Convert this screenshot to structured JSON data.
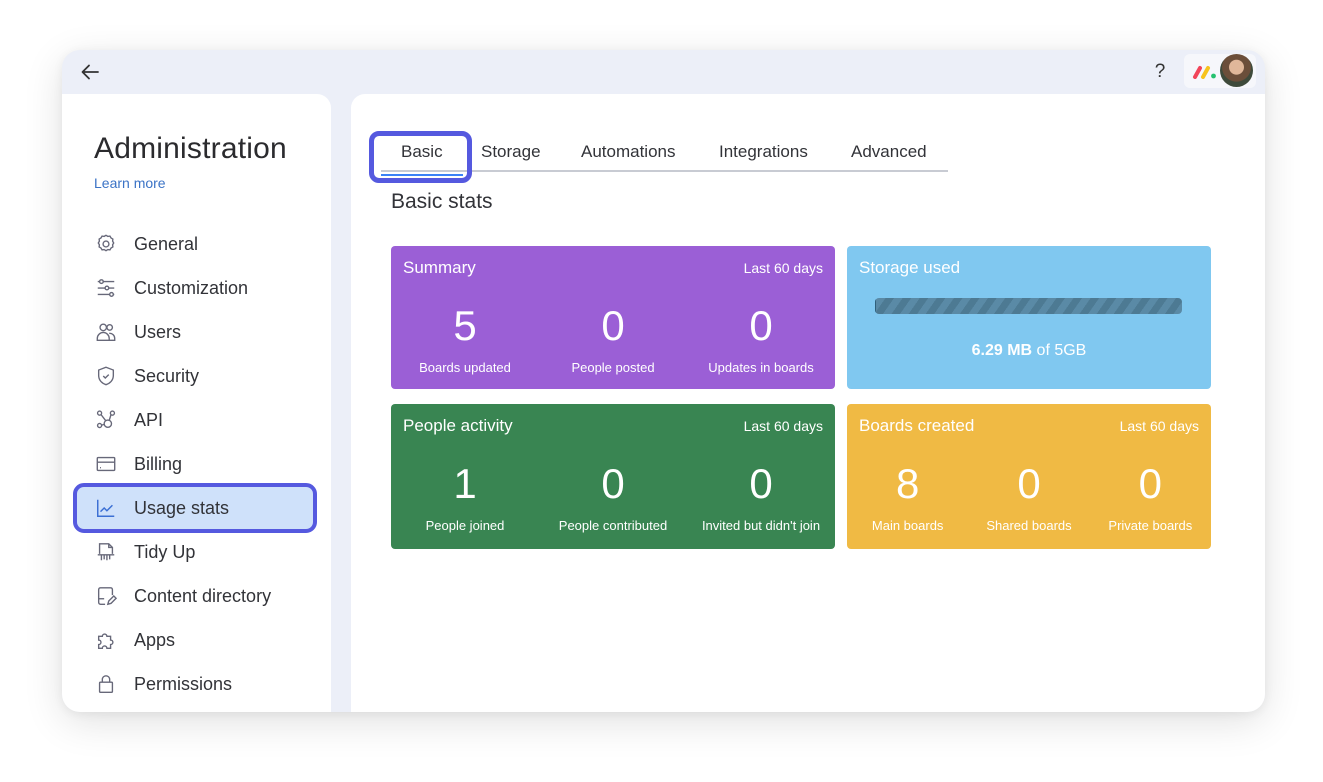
{
  "topbar": {
    "back_icon": "arrow-left-icon",
    "help_label": "?",
    "logo_icon": "monday-logo-icon",
    "avatar_icon": "user-avatar"
  },
  "sidebar": {
    "title": "Administration",
    "learn_more": "Learn more",
    "items": [
      {
        "label": "General",
        "icon": "gear-icon"
      },
      {
        "label": "Customization",
        "icon": "sliders-icon"
      },
      {
        "label": "Users",
        "icon": "users-icon"
      },
      {
        "label": "Security",
        "icon": "shield-check-icon"
      },
      {
        "label": "API",
        "icon": "api-nodes-icon"
      },
      {
        "label": "Billing",
        "icon": "credit-card-icon"
      },
      {
        "label": "Usage stats",
        "icon": "line-chart-icon",
        "active": true
      },
      {
        "label": "Tidy Up",
        "icon": "shredder-icon"
      },
      {
        "label": "Content directory",
        "icon": "document-edit-icon"
      },
      {
        "label": "Apps",
        "icon": "puzzle-icon"
      },
      {
        "label": "Permissions",
        "icon": "lock-icon"
      }
    ]
  },
  "main": {
    "tabs": [
      {
        "label": "Basic",
        "active": true
      },
      {
        "label": "Storage"
      },
      {
        "label": "Automations"
      },
      {
        "label": "Integrations"
      },
      {
        "label": "Advanced"
      }
    ],
    "section_title": "Basic stats",
    "cards": {
      "summary": {
        "title": "Summary",
        "period": "Last 60 days",
        "color": "#9b5fd6",
        "stats": [
          {
            "value": "5",
            "caption": "Boards updated"
          },
          {
            "value": "0",
            "caption": "People posted"
          },
          {
            "value": "0",
            "caption": "Updates in boards"
          }
        ]
      },
      "storage": {
        "title": "Storage used",
        "color": "#80c8f0",
        "used": "6.29 MB",
        "of_text": "of 5GB",
        "used_fraction": 0.0012
      },
      "people": {
        "title": "People activity",
        "period": "Last 60 days",
        "color": "#398552",
        "stats": [
          {
            "value": "1",
            "caption": "People joined"
          },
          {
            "value": "0",
            "caption": "People contributed"
          },
          {
            "value": "0",
            "caption": "Invited but didn't join"
          }
        ]
      },
      "boards": {
        "title": "Boards created",
        "period": "Last 60 days",
        "color": "#f0ba44",
        "stats": [
          {
            "value": "8",
            "caption": "Main boards"
          },
          {
            "value": "0",
            "caption": "Shared boards"
          },
          {
            "value": "0",
            "caption": "Private boards"
          }
        ]
      }
    }
  }
}
